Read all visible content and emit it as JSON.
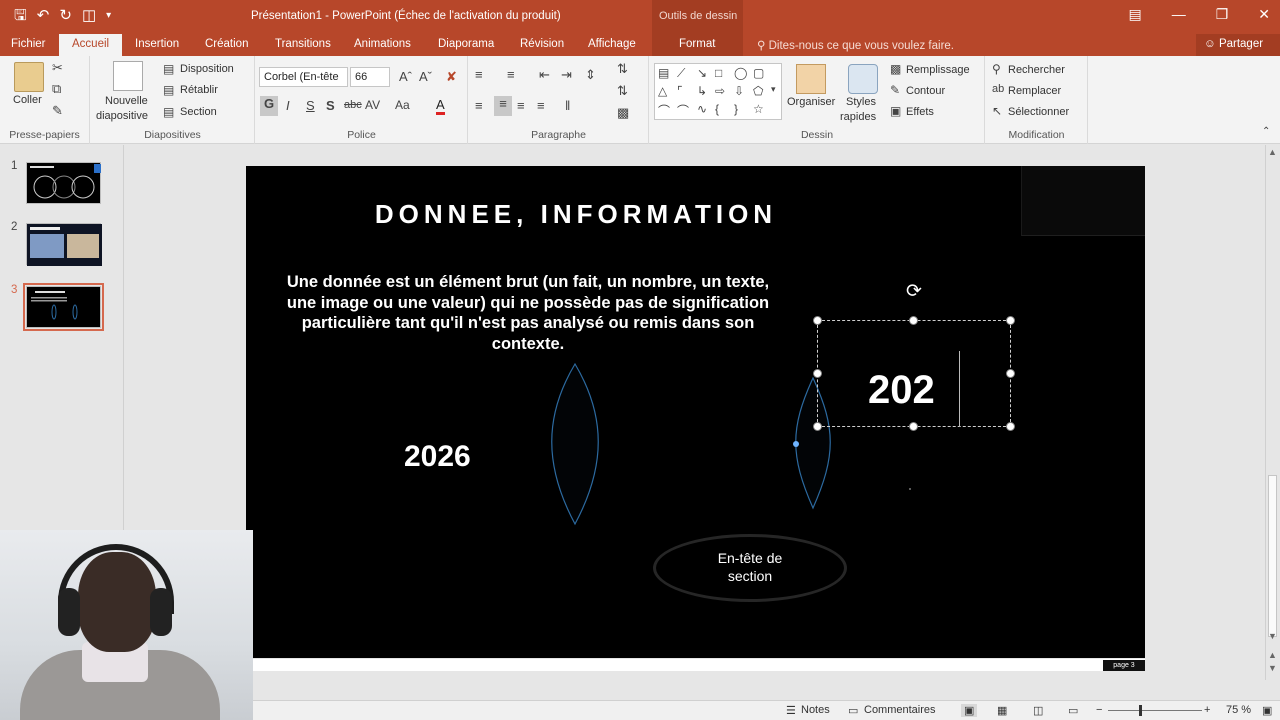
{
  "window": {
    "title": "Présentation1 - PowerPoint (Échec de l'activation du produit)",
    "context_group": "Outils de dessin"
  },
  "tabs": [
    {
      "label": "Fichier"
    },
    {
      "label": "Accueil",
      "active": true
    },
    {
      "label": "Insertion"
    },
    {
      "label": "Création"
    },
    {
      "label": "Transitions"
    },
    {
      "label": "Animations"
    },
    {
      "label": "Diaporama"
    },
    {
      "label": "Révision"
    },
    {
      "label": "Affichage"
    },
    {
      "label": "Format"
    }
  ],
  "tell_me": "Dites-nous ce que vous voulez faire.",
  "share": "Partager",
  "ribbon": {
    "clipboard": {
      "label": "Presse-papiers",
      "paste": "Coller"
    },
    "slides": {
      "label": "Diapositives",
      "new_slide_1": "Nouvelle",
      "new_slide_2": "diapositive",
      "layout": "Disposition",
      "reset": "Rétablir",
      "section": "Section"
    },
    "font": {
      "label": "Police",
      "family": "Corbel (En-tête",
      "size": "66"
    },
    "paragraph": {
      "label": "Paragraphe"
    },
    "drawing": {
      "label": "Dessin",
      "arrange": "Organiser",
      "quick_styles_1": "Styles",
      "quick_styles_2": "rapides",
      "fill": "Remplissage",
      "outline": "Contour",
      "effects": "Effets"
    },
    "editing": {
      "label": "Modification",
      "find": "Rechercher",
      "replace": "Remplacer",
      "select": "Sélectionner"
    }
  },
  "thumbnails": [
    {
      "number": "1"
    },
    {
      "number": "2"
    },
    {
      "number": "3",
      "selected": true
    }
  ],
  "slide": {
    "title": "DONNEE, INFORMATION",
    "body": "Une donnée est un élément brut (un fait, un nombre, un texte, une image ou une valeur) qui ne possède pas de signification particulière tant qu'il n'est pas analysé ou remis dans son contexte.",
    "number_left": "2026",
    "number_editing": "202",
    "section_line1": "En-tête de",
    "section_line2": "section",
    "page_tag": "page 3"
  },
  "status": {
    "notes": "Notes",
    "comments": "Commentaires",
    "zoom": "75 %"
  },
  "colors": {
    "accent": "#b7472a",
    "slide_bg": "#000000",
    "lens_stroke": "#2c6aa0"
  }
}
